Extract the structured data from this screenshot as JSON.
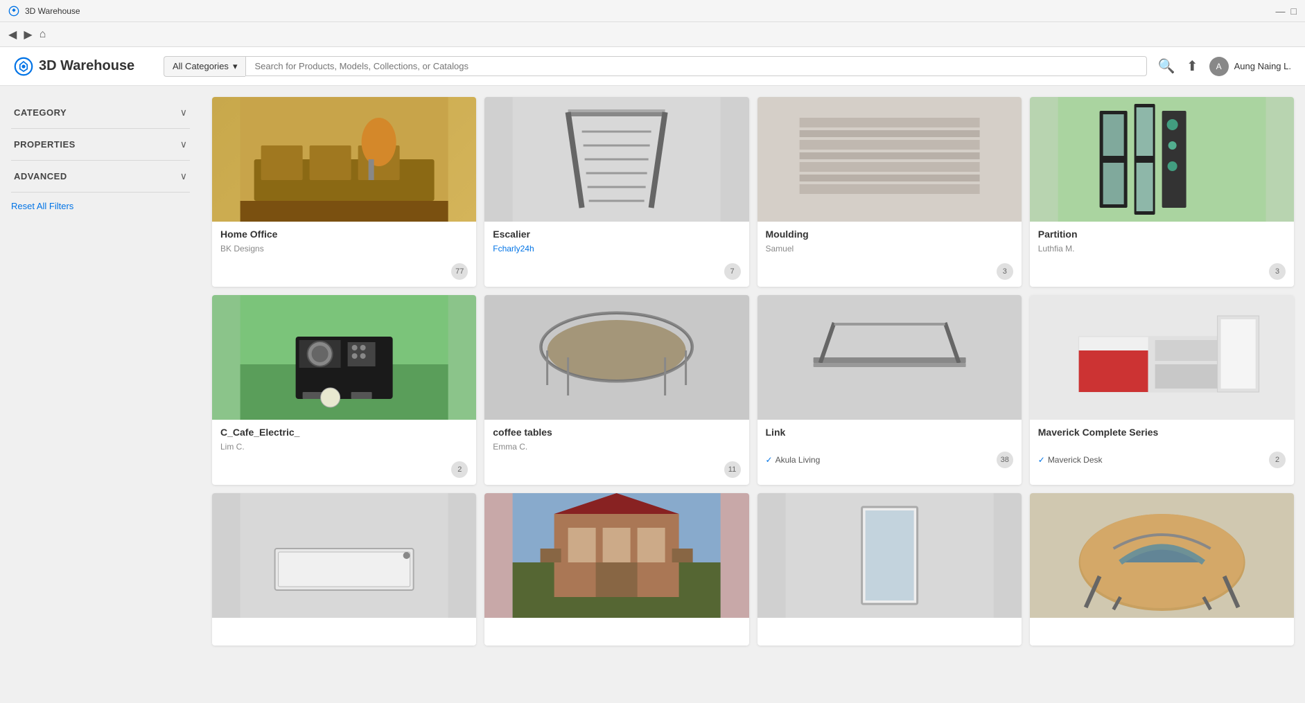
{
  "titleBar": {
    "title": "3D Warehouse",
    "controls": [
      "—",
      "□"
    ]
  },
  "navBar": {
    "back": "◀",
    "forward": "▶",
    "home": "⌂"
  },
  "header": {
    "logoText": "3D Warehouse",
    "categoryDropdown": "All Categories",
    "searchPlaceholder": "Search for Products, Models, Collections, or Catalogs",
    "userName": "Aung Naing L."
  },
  "sidebar": {
    "filters": [
      {
        "label": "CATEGORY",
        "expanded": false
      },
      {
        "label": "PROPERTIES",
        "expanded": false
      },
      {
        "label": "ADVANCED",
        "expanded": false
      }
    ],
    "resetLabel": "Reset All Filters"
  },
  "grid": {
    "cards": [
      {
        "title": "Home Office",
        "author": "BK Designs",
        "count": "77",
        "verified": false,
        "verifiedText": "",
        "imgClass": "img-home-office"
      },
      {
        "title": "Escalier",
        "author": "Fcharly24h",
        "authorColor": "blue",
        "count": "7",
        "verified": false,
        "verifiedText": "",
        "imgClass": "img-escalier"
      },
      {
        "title": "Moulding",
        "author": "Samuel",
        "count": "3",
        "verified": false,
        "verifiedText": "",
        "imgClass": "img-moulding"
      },
      {
        "title": "Partition",
        "author": "Luthfia M.",
        "count": "3",
        "verified": false,
        "verifiedText": "",
        "imgClass": "img-partition"
      },
      {
        "title": "C_Cafe_Electric_",
        "author": "Lim C.",
        "count": "2",
        "verified": false,
        "verifiedText": "",
        "imgClass": "img-cafe"
      },
      {
        "title": "coffee tables",
        "author": "Emma C.",
        "count": "11",
        "verified": false,
        "verifiedText": "",
        "imgClass": "img-coffee"
      },
      {
        "title": "Link",
        "author": "",
        "count": "38",
        "verified": true,
        "verifiedText": "Akula Living",
        "imgClass": "img-link"
      },
      {
        "title": "Maverick Complete Series",
        "author": "",
        "count": "2",
        "verified": true,
        "verifiedText": "Maverick Desk",
        "imgClass": "img-maverick"
      },
      {
        "title": "",
        "author": "",
        "count": "",
        "verified": false,
        "verifiedText": "",
        "imgClass": "img-tray"
      },
      {
        "title": "",
        "author": "",
        "count": "",
        "verified": false,
        "verifiedText": "",
        "imgClass": "img-building"
      },
      {
        "title": "",
        "author": "",
        "count": "",
        "verified": false,
        "verifiedText": "",
        "imgClass": "img-mirror"
      },
      {
        "title": "",
        "author": "",
        "count": "",
        "verified": false,
        "verifiedText": "",
        "imgClass": "img-table"
      }
    ]
  }
}
